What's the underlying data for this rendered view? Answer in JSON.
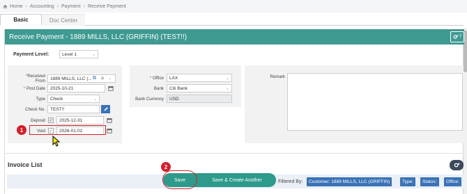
{
  "breadcrumb": [
    "Home",
    "Accounting",
    "Payment",
    "Receive Payment"
  ],
  "tabs": [
    {
      "label": "Basic"
    },
    {
      "label": "Doc Center"
    }
  ],
  "header": {
    "title": "Receive Payment - 1889 MILLS, LLC (GRIFFIN) (TEST!!)",
    "btn_fragment": "T"
  },
  "payment_level": {
    "label": "Payment Level:",
    "value": "Level 1"
  },
  "left": {
    "received_from": {
      "label_1": "Received",
      "label_2": "From",
      "value": "1889 MILLS, LLC (..."
    },
    "post_date": {
      "label": "Post Date",
      "value": "2025-10-21"
    },
    "type": {
      "label": "Type",
      "value": "Check"
    },
    "check_no": {
      "label": "Check No.",
      "value": "TEST!!"
    },
    "deposit": {
      "label": "Deposit",
      "value": "2025-12-31",
      "checked": true
    },
    "void": {
      "label": "Void",
      "value": "2026-01-02",
      "checked": true
    }
  },
  "middle": {
    "office": {
      "label": "Office",
      "value": "LAX"
    },
    "bank": {
      "label": "Bank",
      "value": "Citi Bank"
    },
    "currency": {
      "label": "Bank Currency",
      "value": "USD"
    }
  },
  "remark": {
    "label": "Remark"
  },
  "invoice": {
    "title": "Invoice List"
  },
  "actions": {
    "save": "Save",
    "save_create": "Save & Create Another"
  },
  "filter": {
    "label": "Filtered By:",
    "chips": [
      "Customer: 1889 MILLS, LLC (GRIFFIN)",
      "Type:",
      "Status:",
      "Office:"
    ]
  },
  "annotations": {
    "one": "1",
    "two": "2"
  },
  "colors": {
    "header_bg": "#3f9a92",
    "chip_bg": "#3a73b7",
    "annotation": "#d21f2a"
  }
}
